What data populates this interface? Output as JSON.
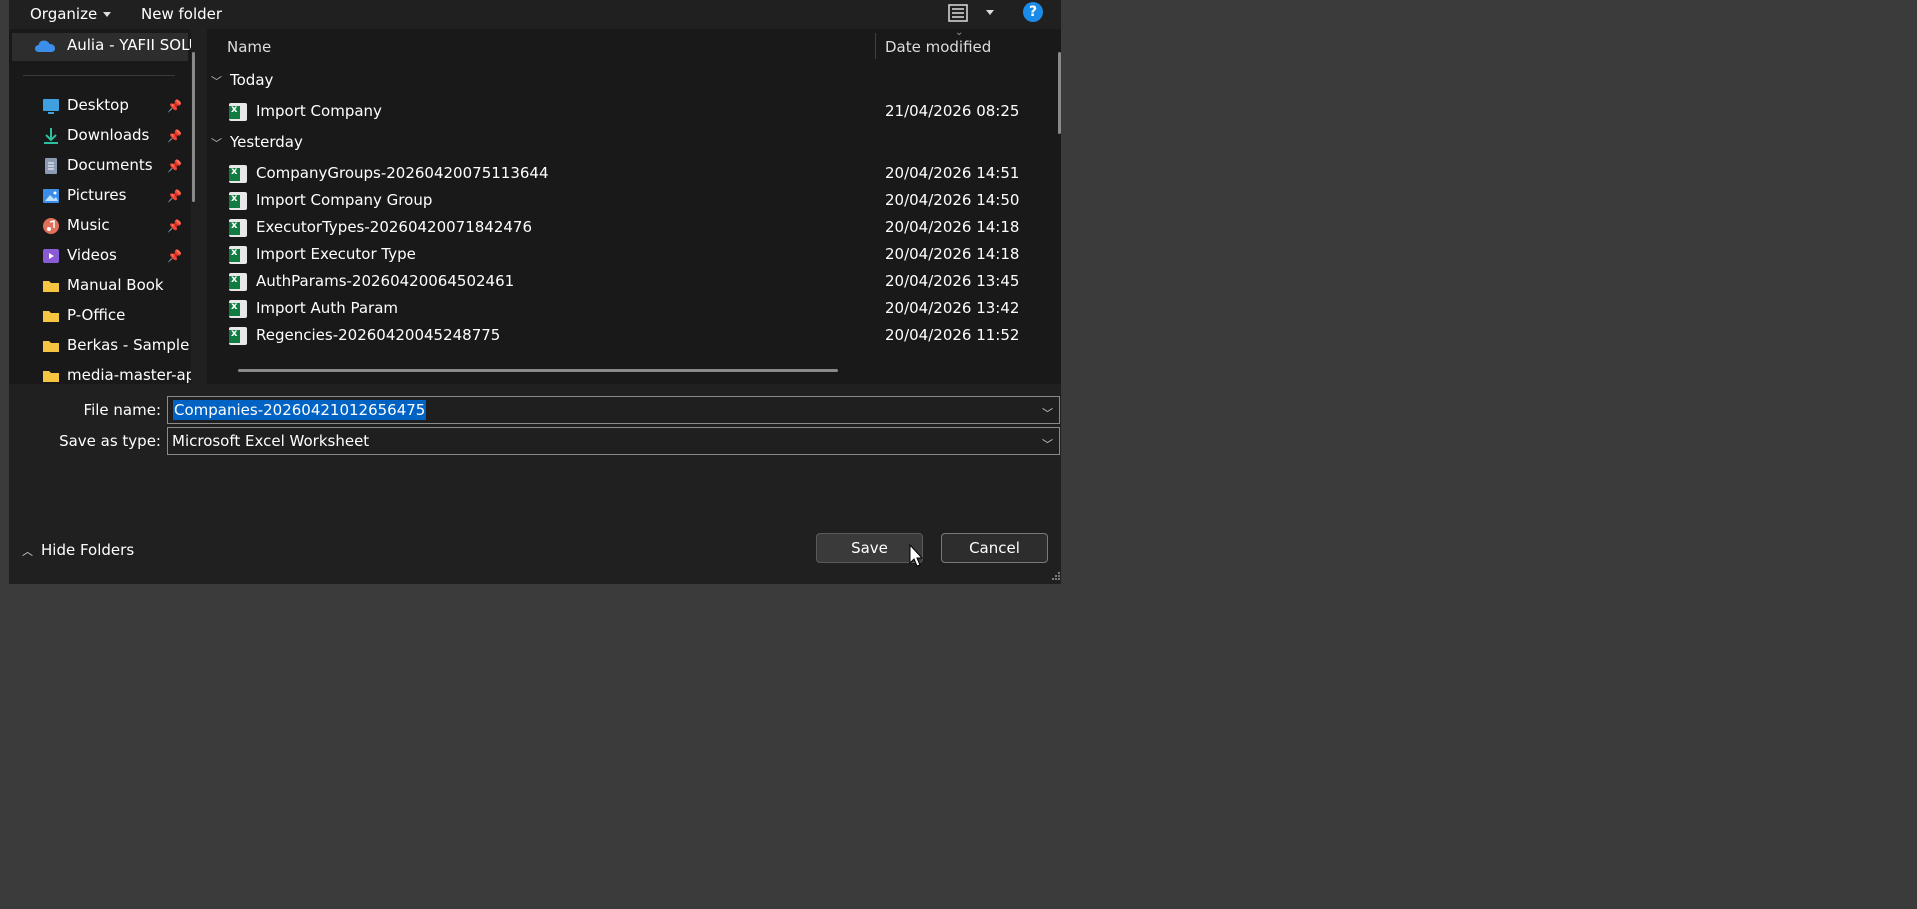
{
  "toolbar": {
    "organize_label": "Organize",
    "new_folder_label": "New folder",
    "view_icon": "list-view-icon",
    "help_label": "?"
  },
  "nav": {
    "cloud_label": "Aulia - YAFII SOLU",
    "items": [
      {
        "label": "Desktop",
        "icon": "desktop-icon",
        "pinned": true
      },
      {
        "label": "Downloads",
        "icon": "download-icon",
        "pinned": true
      },
      {
        "label": "Documents",
        "icon": "documents-icon",
        "pinned": true
      },
      {
        "label": "Pictures",
        "icon": "pictures-icon",
        "pinned": true
      },
      {
        "label": "Music",
        "icon": "music-icon",
        "pinned": true
      },
      {
        "label": "Videos",
        "icon": "videos-icon",
        "pinned": true
      },
      {
        "label": "Manual Book",
        "icon": "folder-icon",
        "pinned": false
      },
      {
        "label": "P-Office",
        "icon": "folder-icon",
        "pinned": false
      },
      {
        "label": "Berkas - Sample F",
        "icon": "folder-icon",
        "pinned": false
      },
      {
        "label": "media-master-ap",
        "icon": "folder-icon",
        "pinned": false
      }
    ]
  },
  "list": {
    "col_name": "Name",
    "col_date": "Date modified",
    "groups": [
      {
        "label": "Today",
        "rows": [
          {
            "name": "Import Company",
            "date": "21/04/2026 08:25"
          }
        ]
      },
      {
        "label": "Yesterday",
        "rows": [
          {
            "name": "CompanyGroups-20260420075113644",
            "date": "20/04/2026 14:51"
          },
          {
            "name": "Import Company Group",
            "date": "20/04/2026 14:50"
          },
          {
            "name": "ExecutorTypes-20260420071842476",
            "date": "20/04/2026 14:18"
          },
          {
            "name": "Import Executor Type",
            "date": "20/04/2026 14:18"
          },
          {
            "name": "AuthParams-20260420064502461",
            "date": "20/04/2026 13:45"
          },
          {
            "name": "Import Auth Param",
            "date": "20/04/2026 13:42"
          },
          {
            "name": "Regencies-20260420045248775",
            "date": "20/04/2026 11:52"
          }
        ]
      }
    ]
  },
  "form": {
    "file_name_label": "File name:",
    "file_name_value": "Companies-20260421012656475",
    "save_type_label": "Save as type:",
    "save_type_value": "Microsoft Excel Worksheet"
  },
  "footer": {
    "hide_folders_label": "Hide Folders",
    "save_label": "Save",
    "cancel_label": "Cancel"
  },
  "colors": {
    "accent": "#0063c4",
    "help": "#1a8be8",
    "excel_green": "#107c41"
  }
}
